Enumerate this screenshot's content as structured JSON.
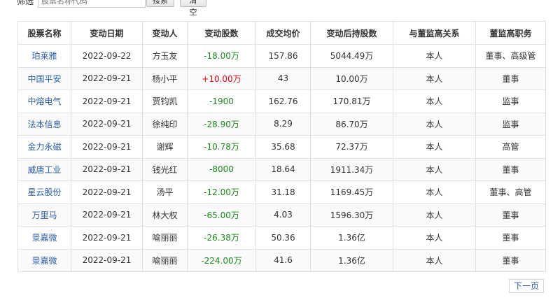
{
  "filter": {
    "label": "筛选",
    "placeholder": "股票名称代码",
    "search_label": "搜索",
    "clear_label": "清空"
  },
  "table": {
    "headers": [
      "股票名称",
      "变动日期",
      "变动人",
      "变动股数",
      "成交均价",
      "变动后持股数",
      "与董监高关系",
      "董监高职务"
    ],
    "rows": [
      {
        "name": "珀莱雅",
        "date": "2022-09-22",
        "person": "方玉友",
        "change": "-18.00万",
        "direction": "neg",
        "price": "157.86",
        "holding": "5044.49万",
        "relation": "本人",
        "position": "董事、高级管"
      },
      {
        "name": "中国平安",
        "date": "2022-09-21",
        "person": "杨小平",
        "change": "+10.00万",
        "direction": "pos",
        "price": "43",
        "holding": "10.00万",
        "relation": "本人",
        "position": "董事"
      },
      {
        "name": "中熔电气",
        "date": "2022-09-21",
        "person": "贾钧凯",
        "change": "-1900",
        "direction": "neg",
        "price": "162.76",
        "holding": "170.81万",
        "relation": "本人",
        "position": "监事"
      },
      {
        "name": "法本信息",
        "date": "2022-09-21",
        "person": "徐纯印",
        "change": "-28.90万",
        "direction": "neg",
        "price": "8.29",
        "holding": "86.70万",
        "relation": "本人",
        "position": "监事"
      },
      {
        "name": "金力永磁",
        "date": "2022-09-21",
        "person": "谢辉",
        "change": "-10.78万",
        "direction": "neg",
        "price": "35.68",
        "holding": "72.37万",
        "relation": "本人",
        "position": "高管"
      },
      {
        "name": "威唐工业",
        "date": "2022-09-21",
        "person": "钱光红",
        "change": "-8000",
        "direction": "neg",
        "price": "18.64",
        "holding": "1911.34万",
        "relation": "本人",
        "position": "董事"
      },
      {
        "name": "星云股份",
        "date": "2022-09-21",
        "person": "汤平",
        "change": "-12.00万",
        "direction": "neg",
        "price": "31.18",
        "holding": "1169.45万",
        "relation": "本人",
        "position": "董事、高管"
      },
      {
        "name": "万里马",
        "date": "2022-09-21",
        "person": "林大权",
        "change": "-65.00万",
        "direction": "neg",
        "price": "4.03",
        "holding": "1596.30万",
        "relation": "本人",
        "position": "董事"
      },
      {
        "name": "景嘉微",
        "date": "2022-09-21",
        "person": "喻丽丽",
        "change": "-26.38万",
        "direction": "neg",
        "price": "50.36",
        "holding": "1.36亿",
        "relation": "本人",
        "position": "董事"
      },
      {
        "name": "景嘉微",
        "date": "2022-09-21",
        "person": "喻丽丽",
        "change": "-224.00万",
        "direction": "neg",
        "price": "41.6",
        "holding": "1.36亿",
        "relation": "本人",
        "position": "董事"
      }
    ]
  },
  "pagination": {
    "next_label": "下一页"
  },
  "colors": {
    "link": "#2a5da8",
    "negative": "#1a8a1a",
    "positive": "#e60012"
  }
}
